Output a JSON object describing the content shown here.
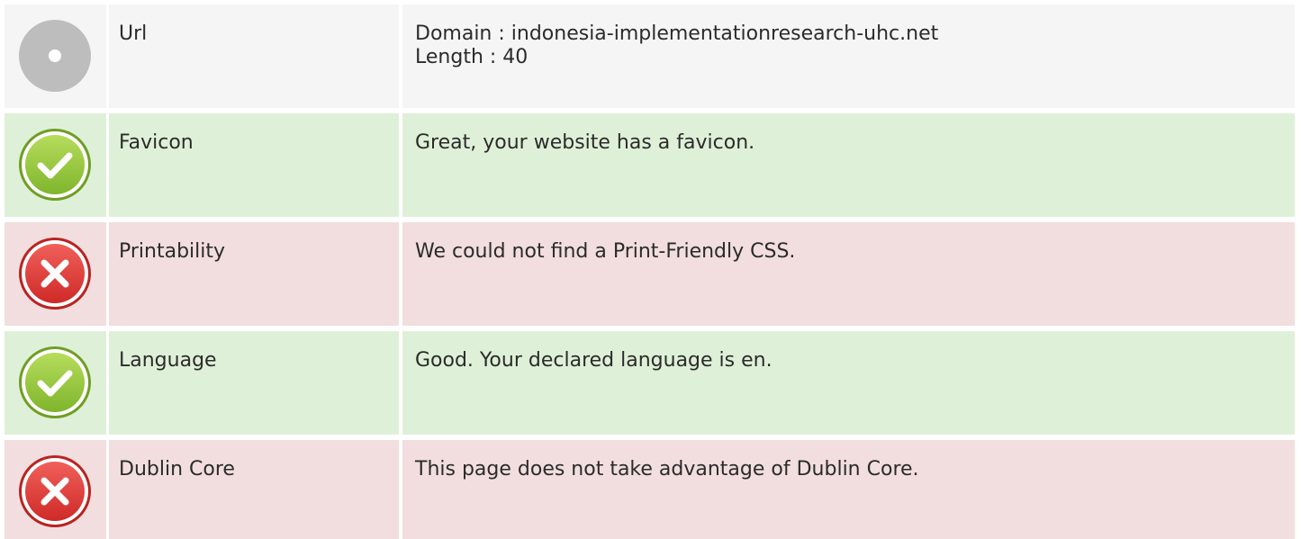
{
  "colors": {
    "neutral_bg": "#f5f5f5",
    "pass_bg": "#dff0d8",
    "fail_bg": "#f2dede",
    "neutral_icon": "#bdbdbd",
    "pass_icon": "#8dc63f",
    "fail_icon": "#e0393a"
  },
  "rows": [
    {
      "status": "neutral",
      "icon": "info-dot-icon",
      "label": "Url",
      "lines": [
        "Domain : indonesia-implementationresearch-uhc.net",
        "Length : 40"
      ]
    },
    {
      "status": "pass",
      "icon": "check-circle-icon",
      "label": "Favicon",
      "lines": [
        "Great, your website has a favicon."
      ]
    },
    {
      "status": "fail",
      "icon": "x-circle-icon",
      "label": "Printability",
      "lines": [
        "We could not find a Print-Friendly CSS."
      ]
    },
    {
      "status": "pass",
      "icon": "check-circle-icon",
      "label": "Language",
      "lines": [
        "Good. Your declared language is en."
      ]
    },
    {
      "status": "fail",
      "icon": "x-circle-icon",
      "label": "Dublin Core",
      "lines": [
        "This page does not take advantage of Dublin Core."
      ]
    }
  ]
}
